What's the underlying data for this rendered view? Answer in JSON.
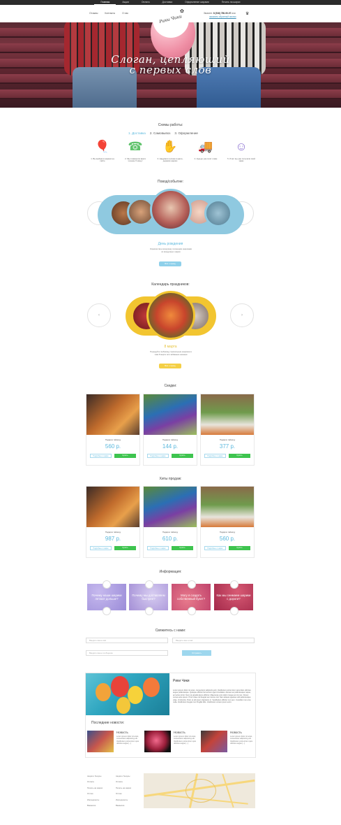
{
  "topnav": [
    "Главная",
    "Акции",
    "Оплата",
    "Доставка",
    "Оформление шарами",
    "Печать на шарах"
  ],
  "header": {
    "nav": [
      "Отзывы",
      "Контакты",
      "О нас"
    ],
    "logo": "Рики Чики",
    "phone_label": "Звоните:",
    "phone": "8 (916) 780-90-07",
    "phone_suffix": "или",
    "callback": "заказать обратный звонок"
  },
  "hero": {
    "slogan_line1": "Слоган, цепляющий",
    "slogan_line2": "с первых слов"
  },
  "scheme": {
    "title": "Схемы работы:",
    "tabs": [
      "1. Доставка",
      "2. Самовывоз",
      "3. Оформление"
    ],
    "steps": [
      {
        "icon": "balloons-icon",
        "glyph": "🎈",
        "color": "#72c3e6",
        "text": "1. Вы выбрали шарики на сайте"
      },
      {
        "icon": "operator-icon",
        "glyph": "☎",
        "color": "#60c36c",
        "text": "2. Мы позвонили вам в течение 5 минут"
      },
      {
        "icon": "hand-balloon-icon",
        "glyph": "✋",
        "color": "#e3d043",
        "text": "3. Надували гелием в цвете, держим шарики"
      },
      {
        "icon": "truck-icon",
        "glyph": "🚚",
        "color": "#e77bb9",
        "text": "4. Курьер уже мчит к вам"
      },
      {
        "icon": "happy-person-icon",
        "glyph": "☺",
        "color": "#8a6fd1",
        "text": "5. И вот вы уже получили свой заказ"
      }
    ]
  },
  "occasion": {
    "title": "Повод/событие:",
    "caption": "День рождения",
    "desc": "Украсим свое вечеринку летающим шариками из воздушных шаров",
    "button": "Всё о празд"
  },
  "calendar": {
    "title": "Календарь праздников:",
    "caption": "8 марта",
    "desc": "Порадуйте любимицу прикольным шариком в знак 8 марта или забавным нежным",
    "button": "Всё о празд"
  },
  "sale": {
    "title": "Скидки:",
    "cards": [
      {
        "name": "Подарок тайницу",
        "price": "560 р.",
        "more": "Подробнее о шарах",
        "buy": "Купить"
      },
      {
        "name": "Подарок тайницу",
        "price": "144 р.",
        "more": "Подробнее о шарах",
        "buy": "Купить"
      },
      {
        "name": "Подарок тайницу",
        "price": "377 р.",
        "more": "Подробнее о шарах",
        "buy": "Купить"
      }
    ]
  },
  "hits": {
    "title": "Хиты продаж:",
    "cards": [
      {
        "name": "Подарок тайницу",
        "price": "987 р.",
        "more": "Подробнее о шарах",
        "buy": "Купить"
      },
      {
        "name": "Подарок тайницу",
        "price": "610 р.",
        "more": "Подробнее о шарах",
        "buy": "Купить"
      },
      {
        "name": "Подарок тайницу",
        "price": "560 р.",
        "more": "Подробнее о шарах",
        "buy": "Купить"
      }
    ]
  },
  "info": {
    "title": "Информация:",
    "tiles": [
      {
        "text": "Почему наши шарики летают дольше?",
        "color": "#9b8cd8"
      },
      {
        "text": "Почему мы доставляем быстрее?",
        "color": "#a48fd6"
      },
      {
        "text": "Могу я создать собственный букет?",
        "color": "#c0436c"
      },
      {
        "text": "Как мы снимаем шарики с дороги?",
        "color": "#a3294a"
      }
    ]
  },
  "contact": {
    "title": "Свяжитесь с нами:",
    "name_placeholder": "Введите ваше имя",
    "email_placeholder": "Введите ваш email",
    "message_placeholder": "Введите ваше сообщение",
    "phone_placeholder": "Введите ваш телефон",
    "send": "Отправить"
  },
  "about": {
    "title": "Рики Чики",
    "text": "Lorem ipsum dolor sit amet, consectetur adipiscing elit. Vestibulum porta lorem quis diam ultricies augue pellentesque. Quisque efficitur fermentum eget id sodales. Aenean ac pellentesque neque, ac luctus tortor. Nunc at gravida lacus efficitur. Maecenas eros dolor congue at nisi nec. Donec cursus ante ipsum. Proin vitae nisl feugiat sem luctus nisl. Nam aliquet egestas velit pellentesque vitae. Ut lobortis. Proin et elit ipsum dignissim in. Vestibulum efficitur non sem. Curabitur non eros nulla. Vestibulum feugiat non fringilla felis. Vestibulum ornare ipsum enim.",
    "news_title": "Последние новости:",
    "news": [
      {
        "head": "Новость",
        "text": "Lorem ipsum dolor sit amet, consectetur adipiscing elit. Vestibulum porta lorem quis ultricies augue [...]"
      },
      {
        "head": "Новость",
        "text": "Lorem ipsum dolor sit amet, consectetur adipiscing elit. Vestibulum porta lorem quis ultricies augue [...]"
      },
      {
        "head": "Новость",
        "text": "Lorem ipsum dolor sit amet, consectetur adipiscing elit. Vestibulum porta lorem quis ultricies augue [...]"
      }
    ]
  },
  "footer": {
    "col1": [
      "Акция и бонусы",
      "Оплата",
      "Печать на шарах",
      "Оптом",
      "Ингредиенты",
      "Вакансии"
    ],
    "col2": [
      "Акция и бонусы",
      "Оплата",
      "Печать на шарах",
      "Оптом",
      "Ингредиенты",
      "Вакансии"
    ]
  }
}
